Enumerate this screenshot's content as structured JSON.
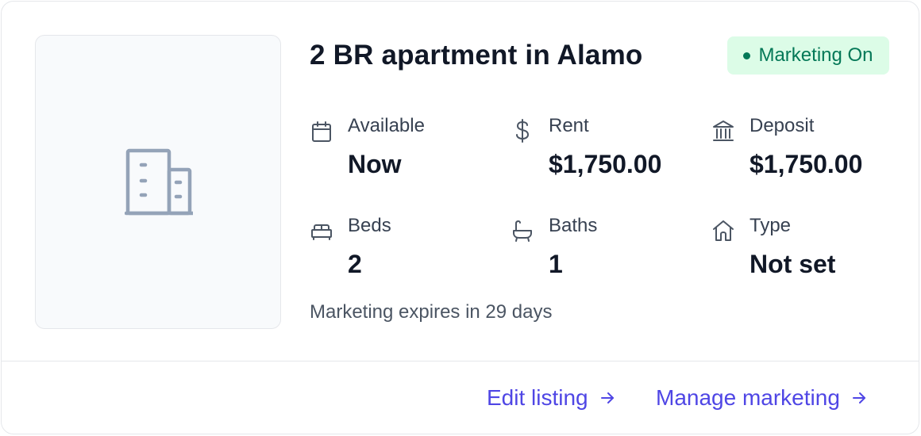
{
  "listing": {
    "title": "2 BR apartment in Alamo",
    "image_placeholder_icon": "building-icon"
  },
  "badge": {
    "label": "Marketing On",
    "color": "#047857",
    "background": "#dcfce7"
  },
  "stats": {
    "available": {
      "label": "Available",
      "value": "Now",
      "icon": "calendar-icon"
    },
    "rent": {
      "label": "Rent",
      "value": "$1,750.00",
      "icon": "dollar-icon"
    },
    "deposit": {
      "label": "Deposit",
      "value": "$1,750.00",
      "icon": "bank-icon"
    },
    "beds": {
      "label": "Beds",
      "value": "2",
      "icon": "bed-icon"
    },
    "baths": {
      "label": "Baths",
      "value": "1",
      "icon": "bathtub-icon"
    },
    "type": {
      "label": "Type",
      "value": "Not set",
      "icon": "home-icon"
    }
  },
  "expires_text": "Marketing expires in 29 days",
  "actions": {
    "edit_label": "Edit listing",
    "manage_label": "Manage marketing",
    "link_color": "#4f46e5"
  }
}
